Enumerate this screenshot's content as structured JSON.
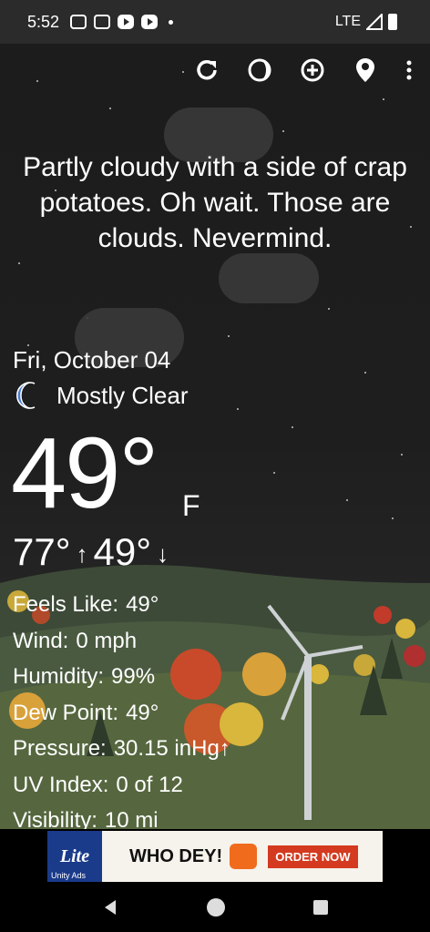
{
  "status": {
    "time": "5:52",
    "network": "LTE"
  },
  "toolbar": {
    "icons": [
      "refresh-icon",
      "theme-icon",
      "add-location-icon",
      "location-pin-icon",
      "more-vert-icon"
    ]
  },
  "headline": "Partly cloudy with a side of crap potatoes. Oh wait. Those are clouds. Nevermind.",
  "weather": {
    "date": "Fri, October 04",
    "condition": "Mostly Clear",
    "temp": "49°",
    "unit": "F",
    "high": "77°",
    "low": "49°",
    "details": [
      {
        "label": "Feels Like:",
        "value": "49°"
      },
      {
        "label": "Wind:",
        "value": "0 mph"
      },
      {
        "label": "Humidity:",
        "value": "99%"
      },
      {
        "label": "Dew Point:",
        "value": "49°"
      },
      {
        "label": "Pressure:",
        "value": "30.15 inHg↑"
      },
      {
        "label": "UV Index:",
        "value": "0 of 12"
      },
      {
        "label": "Visibility:",
        "value": "10 mi"
      }
    ]
  },
  "ad": {
    "brand": "Lite",
    "text": "WHO DEY!",
    "cta": "ORDER NOW",
    "network": "Unity Ads"
  },
  "colors": {
    "moon": "#4a7fd6",
    "ad_red": "#d33a1f",
    "ad_orange": "#f06b1c"
  }
}
